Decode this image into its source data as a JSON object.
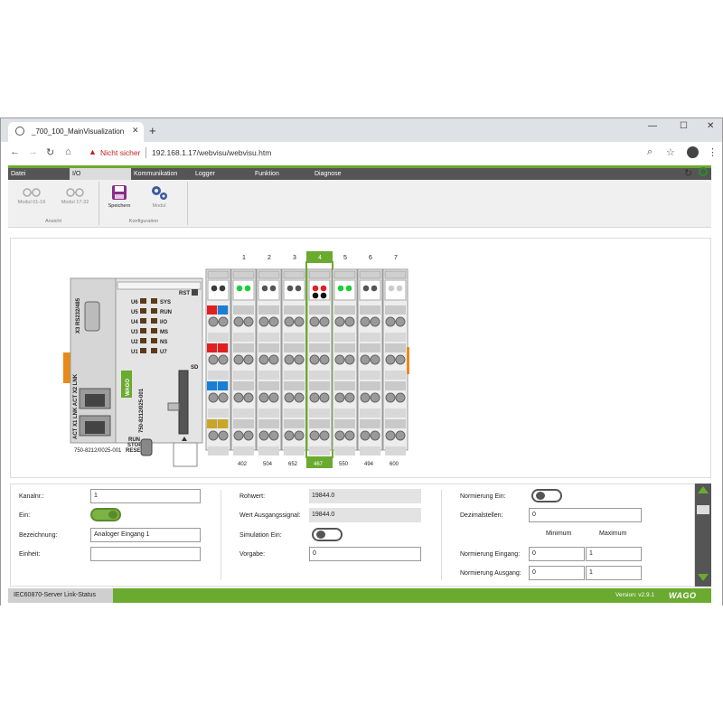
{
  "browser": {
    "tab_title": "_700_100_MainVisualization",
    "new_tab": "+",
    "security_label": "Nicht sicher",
    "url": "192.168.1.17/webvisu/webvisu.htm"
  },
  "menu": {
    "items": [
      "Datei",
      "I/O",
      "Kommunikation",
      "Logger",
      "Funktion",
      "Diagnose"
    ],
    "active": "I/O"
  },
  "ribbon": {
    "modul_01_16": "Modul 01-16",
    "modul_17_32": "Modul 17-32",
    "group_ansicht": "Ansicht",
    "speichern": "Speichern",
    "modul": "Modul",
    "group_konfiguration": "Konfiguration"
  },
  "controller": {
    "label": "750-8212/0025-001",
    "side_text": "750-8212/025-001",
    "port_text": "X3 RS232/485",
    "led_left": [
      "U6",
      "U5",
      "U4",
      "U3",
      "U2",
      "U1"
    ],
    "led_right": [
      "SYS",
      "RUN",
      "I/O",
      "MS",
      "NS",
      "U7"
    ],
    "rst": "RST",
    "sd": "SD",
    "switch": [
      "RUN",
      "STOP",
      "RESET"
    ],
    "wago": "WAGO"
  },
  "slots": {
    "numbers": [
      "1",
      "2",
      "3",
      "4",
      "5",
      "6",
      "7"
    ],
    "module_ids": [
      "402",
      "504",
      "652",
      "467",
      "550",
      "494",
      "600"
    ],
    "selected": "4"
  },
  "form": {
    "kanalnr_label": "Kanalnr.:",
    "kanalnr_value": "1",
    "ein_label": "Ein:",
    "bezeichnung_label": "Bezeichnung:",
    "bezeichnung_value": "Analoger Eingang 1",
    "einheit_label": "Einheit:",
    "einheit_value": "",
    "rohwert_label": "Rohwert:",
    "rohwert_value": "19844.0",
    "wert_ausgang_label": "Wert Ausgangssignal:",
    "wert_ausgang_value": "19844.0",
    "simulation_label": "Simulation Ein:",
    "vorgabe_label": "Vorgabe:",
    "vorgabe_value": "0",
    "normierung_ein_label": "Normierung Ein:",
    "dezimalstellen_label": "Dezimalstellen:",
    "dezimalstellen_value": "0",
    "minimum_label": "Minimum",
    "maximum_label": "Maximum",
    "norm_eingang_label": "Normierung Eingang:",
    "norm_eingang_min": "0",
    "norm_eingang_max": "1",
    "norm_ausgang_label": "Normierung Ausgang:",
    "norm_ausgang_min": "0",
    "norm_ausgang_max": "1"
  },
  "status": {
    "tab_label": "IEC60870-Server Link-Status",
    "version": "Version: v2.9.1",
    "logo": "WAGO"
  },
  "colors": {
    "accent_green": "#6aaa2f",
    "menu_dark": "#555555",
    "warning_red": "#c5221f"
  }
}
